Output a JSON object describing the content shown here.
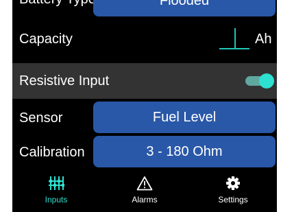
{
  "rows": {
    "battery_type": {
      "label": "Battery Type",
      "value": "Flooded"
    },
    "capacity": {
      "label": "Capacity",
      "value": "",
      "unit": "Ah"
    },
    "resistive_input": {
      "label": "Resistive Input",
      "enabled": true
    },
    "sensor": {
      "label": "Sensor",
      "value": "Fuel Level"
    },
    "calibration": {
      "label": "Calibration",
      "value": "3 - 180 Ohm"
    }
  },
  "nav": {
    "tabs": [
      {
        "label": "Inputs",
        "icon": "inputs-icon",
        "active": true
      },
      {
        "label": "Alarms",
        "icon": "warning-triangle-icon",
        "active": false
      },
      {
        "label": "Settings",
        "icon": "gear-icon",
        "active": false
      }
    ]
  },
  "colors": {
    "accent": "#2ee0cf",
    "button_blue": "#2a58a8",
    "row_highlight": "#333333",
    "background": "#000000"
  }
}
